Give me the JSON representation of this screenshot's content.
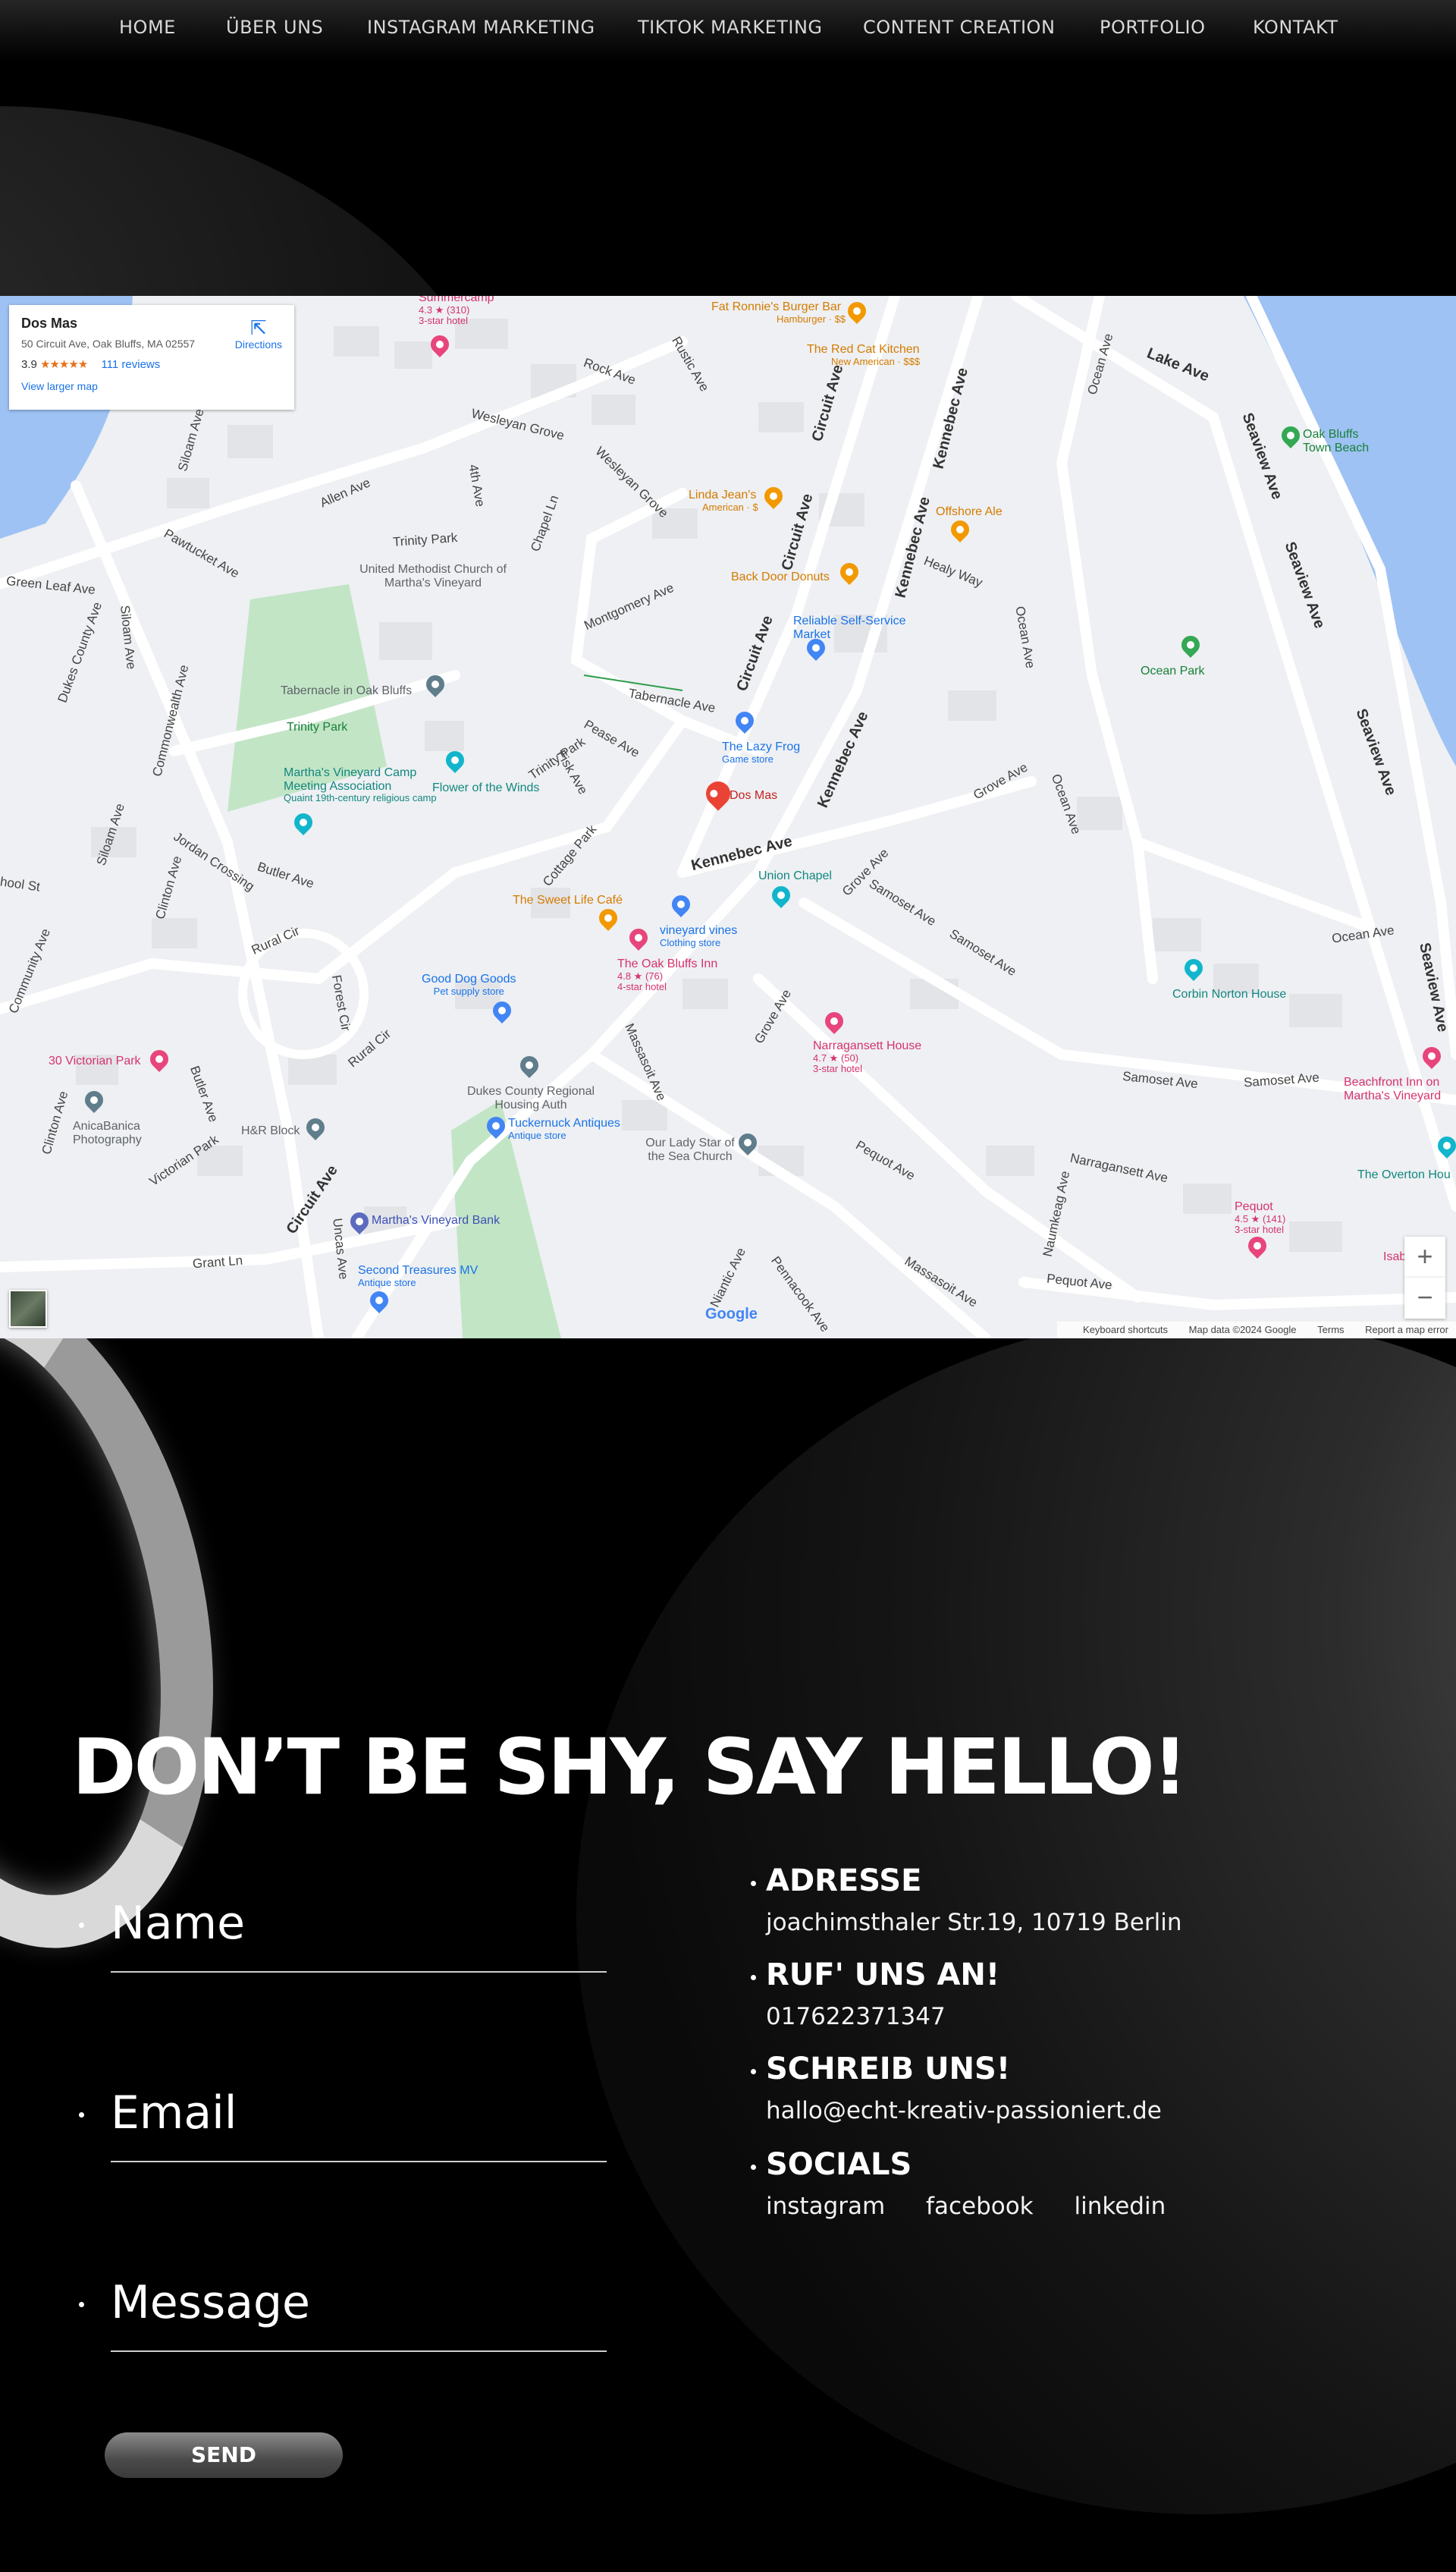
{
  "nav": {
    "items": [
      "HOME",
      "ÜBER UNS",
      "INSTAGRAM MARKETING",
      "TIKTOK MARKETING",
      "CONTENT CREATION",
      "PORTFOLIO",
      "KONTAKT"
    ]
  },
  "map": {
    "card": {
      "title": "Dos Mas",
      "address": "50 Circuit Ave, Oak Bluffs, MA 02557",
      "rating": "3.9",
      "stars": "★★★★★",
      "reviews": "111 reviews",
      "directions": "Directions",
      "larger_map": "View larger map"
    },
    "streets": {
      "circuit1": "Circuit Ave",
      "circuit2": "Circuit Ave",
      "circuit3": "Circuit Ave",
      "circuit4": "Circuit Ave",
      "kennebec1": "Kennebec Ave",
      "kennebec2": "Kennebec Ave",
      "kennebec3": "Kennebec Ave",
      "kennebec4": "Kennebec Ave",
      "lake": "Lake Ave",
      "seaview1": "Seaview Ave",
      "seaview2": "Seaview Ave",
      "seaview3": "Seaview Ave",
      "seaview4": "Seaview Ave",
      "ocean1": "Ocean Ave",
      "ocean2": "Ocean Ave",
      "ocean3": "Ocean Ave",
      "ocean4": "Ocean Ave",
      "samoset1": "Samoset Ave",
      "samoset2": "Samoset Ave",
      "samoset3": "Samoset Ave",
      "samoset4": "Samoset Ave",
      "pequot1": "Pequot Ave",
      "pequot2": "Pequot Ave",
      "narragansett": "Narragansett Ave",
      "massasoit1": "Massasoit Ave",
      "massasoit2": "Massasoit Ave",
      "grove1": "Grove Ave",
      "grove2": "Grove Ave",
      "grove3": "Grove Ave",
      "rock": "Rock Ave",
      "wesleyan1": "Wesleyan Grove",
      "wesleyan2": "Wesleyan Grove",
      "trinity1": "Trinity Park",
      "trinity2": "Trinity Park",
      "montgomery": "Montgomery Ave",
      "tabernacle": "Tabernacle Ave",
      "pease": "Pease Ave",
      "fisk": "Fisk Ave",
      "cottage": "Cottage Park",
      "healy": "Healy Way",
      "allen": "Allen Ave",
      "pawtucket": "Pawtucket Ave",
      "green_leaf": "Green Leaf Ave",
      "dukes": "Dukes County Ave",
      "siloam1": "Siloam Ave",
      "siloam2": "Siloam Ave",
      "siloam3": "Siloam Ave",
      "commonwealth": "Commonwealth Ave",
      "jordan": "Jordan Crossing",
      "butler1": "Butler Ave",
      "butler2": "Butler Ave",
      "clinton1": "Clinton Ave",
      "clinton2": "Clinton Ave",
      "rural1": "Rural Cir",
      "rural2": "Rural Cir",
      "forest": "Forest Cir",
      "victorian": "Victorian Park",
      "grant": "Grant Ln",
      "uncas": "Uncas Ave",
      "niantic": "Niantic Ave",
      "pennacook": "Pennacook Ave",
      "naumkeag": "Naumkeag Ave",
      "school": "hool St",
      "community": "Community Ave",
      "chapel": "Chapel Ln",
      "fourth": "4th Ave",
      "rustic": "Rustic Ave"
    },
    "pois": {
      "summercamp": "Summercamp",
      "summercamp_sub1": "4.3 ★ (310)",
      "summercamp_sub2": "3-star hotel",
      "fat_ronnies": "Fat Ronnie's Burger Bar",
      "fat_ronnies_sub": "Hamburger · $$",
      "red_cat": "The Red Cat Kitchen",
      "red_cat_sub": "New American · $$$",
      "oak_bluffs_beach": "Oak Bluffs Town Beach",
      "linda_jeans": "Linda Jean's",
      "linda_jeans_sub": "American · $",
      "offshore_ale": "Offshore Ale",
      "united_methodist": "United Methodist Church of Martha's Vineyard",
      "back_door": "Back Door Donuts",
      "reliable": "Reliable Self-Service Market",
      "ocean_park": "Ocean Park",
      "tabernacle": "Tabernacle in Oak Bluffs",
      "trinity_park": "Trinity Park",
      "lazy_frog": "The Lazy Frog",
      "lazy_frog_sub": "Game store",
      "camp_meeting": "Martha's Vineyard Camp Meeting Association",
      "camp_meeting_sub": "Quaint 19th-century religious camp",
      "flower_winds": "Flower of the Winds",
      "dos_mas": "Dos Mas",
      "union_chapel": "Union Chapel",
      "sweet_life": "The Sweet Life Café",
      "vineyard_vines": "vineyard vines",
      "vineyard_vines_sub": "Clothing store",
      "oak_bluffs_inn": "The Oak Bluffs Inn",
      "oak_bluffs_inn_sub1": "4.8 ★ (76)",
      "oak_bluffs_inn_sub2": "4-star hotel",
      "good_dog": "Good Dog Goods",
      "good_dog_sub": "Pet supply store",
      "corbin": "Corbin Norton House",
      "victorian_park": "30 Victorian Park",
      "narragansett_house": "Narragansett House",
      "narragansett_sub1": "4.7 ★ (50)",
      "narragansett_sub2": "3-star hotel",
      "beachfront": "Beachfront Inn on Martha's Vineyard",
      "dukes_housing": "Dukes County Regional Housing Auth",
      "anicabanica": "AnicaBanica Photography",
      "hr_block": "H&R Block",
      "tuckernuck": "Tuckernuck Antiques",
      "tuckernuck_sub": "Antique store",
      "our_lady": "Our Lady Star of the Sea Church",
      "overton": "The Overton Hou",
      "mv_bank": "Martha's Vineyard Bank",
      "pequot": "Pequot",
      "pequot_sub1": "4.5 ★ (141)",
      "pequot_sub2": "3-star hotel",
      "isab": "Isab",
      "second_treasures": "Second Treasures MV",
      "second_treasures_sub": "Antique store"
    },
    "zoom_in": "+",
    "zoom_out": "−",
    "google": "Google",
    "footer": {
      "shortcuts": "Keyboard shortcuts",
      "data": "Map data ©2024 Google",
      "terms": "Terms",
      "report": "Report a map error"
    },
    "colors": {
      "water": "#9ec2f4",
      "park": "#c2e5c6",
      "road": "#ffffff",
      "land": "#eef0f3",
      "pin": "#ea4335"
    }
  },
  "contact": {
    "headline": "DON’T BE SHY, SAY HELLO!",
    "form": {
      "name_label": "Name",
      "email_label": "Email",
      "message_label": "Message",
      "send_label": "SEND"
    },
    "info": {
      "address_heading": "ADRESSE",
      "address_value": "joachimsthaler Str.19, 10719 Berlin",
      "phone_heading": "RUF' UNS AN!",
      "phone_value": "017622371347",
      "email_heading": "SCHREIB UNS!",
      "email_value": "hallo@echt-kreativ-passioniert.de",
      "socials_heading": "SOCIALS",
      "socials": [
        "instagram",
        "facebook",
        "linkedin"
      ]
    }
  }
}
